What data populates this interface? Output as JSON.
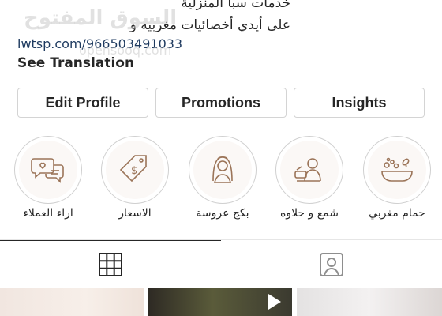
{
  "bio": {
    "line1": "خدمات سبا المنزلية",
    "line2": "على أيدي أخصائيات مغربيه و",
    "line3": "lwtsp.com/966503491033",
    "see_translation": "See Translation"
  },
  "watermark": {
    "text": "السوق المفتوح",
    "sub": "opensooq.com"
  },
  "buttons": {
    "edit_profile": "Edit Profile",
    "promotions": "Promotions",
    "insights": "Insights"
  },
  "highlights": [
    {
      "label": "اراء العملاء",
      "icon": "chat-bubbles-icon"
    },
    {
      "label": "الاسعار",
      "icon": "price-tag-icon"
    },
    {
      "label": "بكج عروسة",
      "icon": "bride-icon"
    },
    {
      "label": "شمع و حلاوه",
      "icon": "waxing-icon"
    },
    {
      "label": "حمام مغربي",
      "icon": "bath-icon"
    }
  ],
  "tabs": [
    {
      "name": "grid",
      "icon": "grid-icon"
    },
    {
      "name": "tagged",
      "icon": "tagged-person-icon"
    }
  ],
  "colors": {
    "icon_stroke": "#9b7458",
    "link": "#1e3a5f",
    "border": "#d4d4d4"
  }
}
